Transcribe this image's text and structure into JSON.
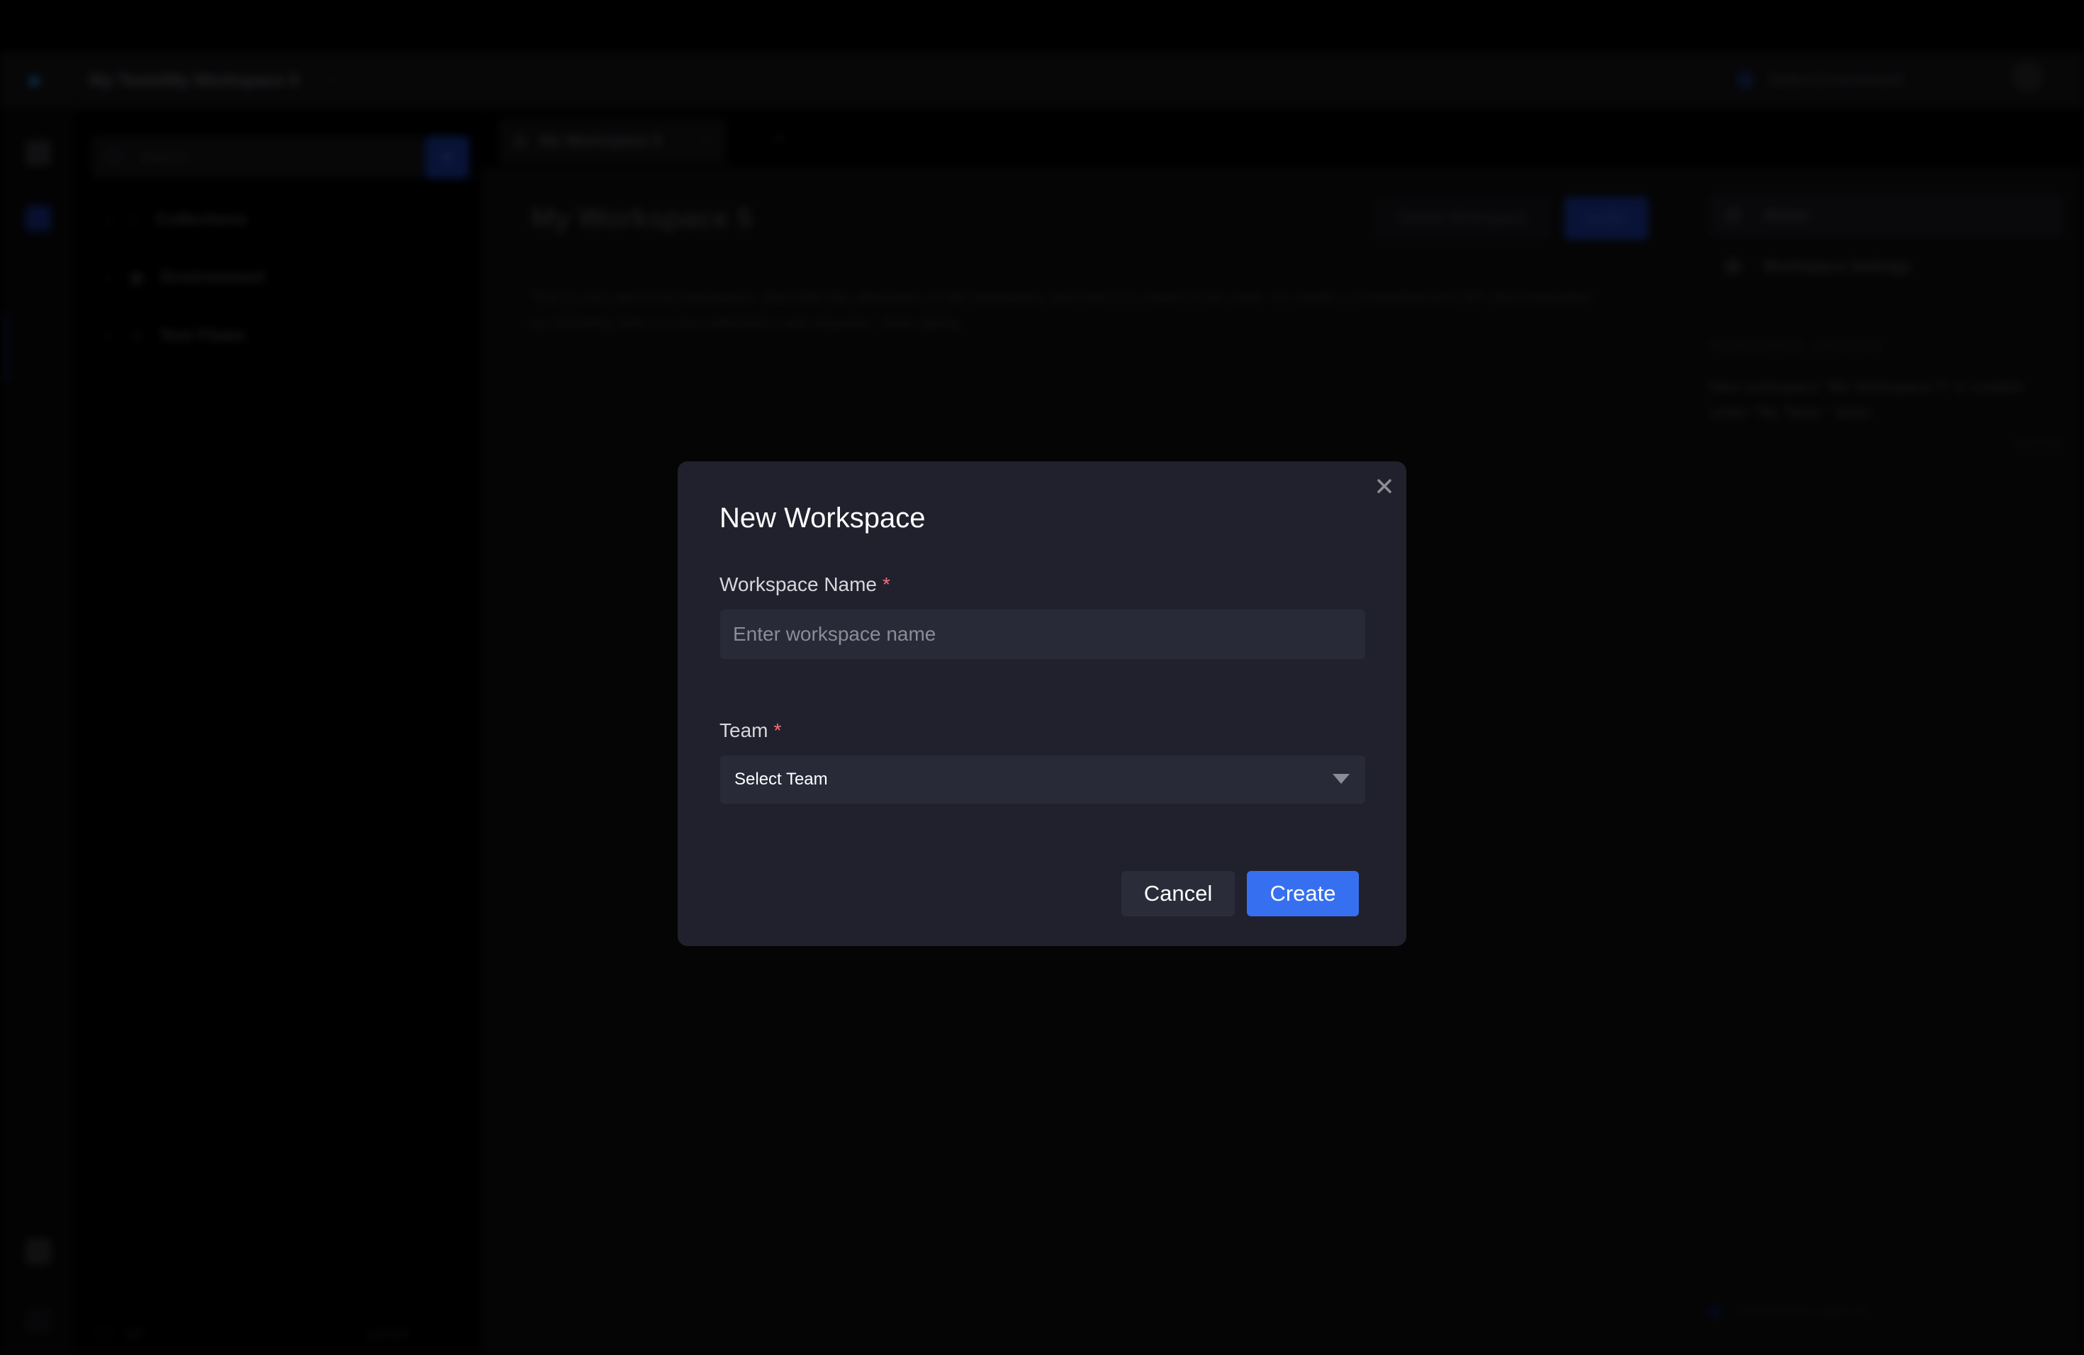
{
  "header": {
    "breadcrumb": "My Team/My Workspace 5",
    "environment_label": "Select Environment"
  },
  "sidebar": {
    "search_placeholder": "Search",
    "add_label": "+",
    "items": [
      {
        "label": "Collections",
        "icon": "folder-icon"
      },
      {
        "label": "Environment",
        "icon": "environment-icon"
      },
      {
        "label": "Test Flows",
        "icon": "flow-icon"
      }
    ],
    "footer_label": "10",
    "version": "v2.0.0"
  },
  "tabs": [
    {
      "label": "My Workspace 5"
    }
  ],
  "main": {
    "title": "My Workspace 5",
    "delete_label": "Delete Workspace",
    "invite_label": "Invite",
    "description": "This is your personal workspace. Describe the objectives of the workspace and how it is meant to be used. Or create a comprehensive API documentation by including links to your collections and requests. Start typing."
  },
  "right_panel": {
    "items": [
      {
        "label": "About",
        "active": true
      },
      {
        "label": "Workspace Settings",
        "active": false
      }
    ],
    "updates_heading": "WORKSPACE UPDATES",
    "update_text": "New workspace \"My Workspace 5\" is created under \"My Team \" team",
    "update_time": "Just now",
    "powered_by": "Powered By Sparrow"
  },
  "modal": {
    "title": "New Workspace",
    "name_label": "Workspace Name",
    "name_required": "*",
    "name_value": "",
    "name_placeholder": "Enter workspace name",
    "team_label": "Team",
    "team_required": "*",
    "team_selected": "Select Team",
    "cancel_label": "Cancel",
    "create_label": "Create",
    "colors": {
      "background": "#21212d",
      "input": "#282a38",
      "primary": "#3670f0",
      "required": "#f3707a"
    }
  }
}
